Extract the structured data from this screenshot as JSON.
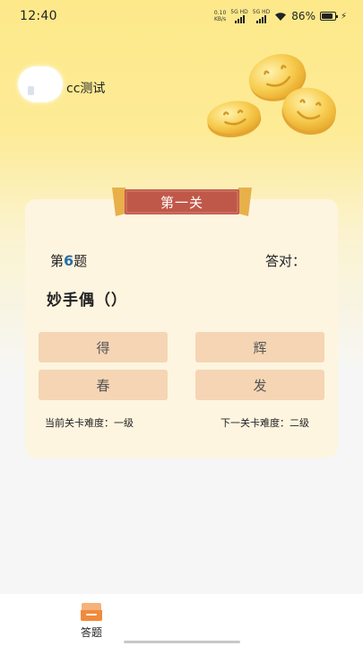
{
  "status_bar": {
    "time": "12:40",
    "net_speed_value": "0.10",
    "net_speed_unit": "KB/s",
    "sim1": "5G HD",
    "sim2": "5G HD",
    "battery": "86%"
  },
  "profile": {
    "username": "cc测试"
  },
  "level": {
    "title": "第一关"
  },
  "question": {
    "prefix": "第",
    "number": "6",
    "suffix": "题",
    "correct_label": "答对：",
    "text": "妙手偶（）",
    "options": [
      "得",
      "辉",
      "春",
      "发"
    ]
  },
  "difficulty": {
    "current": "当前关卡难度：一级",
    "next": "下一关卡难度：二级"
  },
  "bottom_nav": {
    "items": [
      {
        "label": "答题",
        "icon": "quiz-tray-icon"
      }
    ]
  },
  "colors": {
    "accent": "#c0584a",
    "banner_gold": "#e8b04a",
    "option_bg": "#f5d5b4",
    "card_bg": "#fdf5e0",
    "question_number": "#2a6fa8"
  }
}
